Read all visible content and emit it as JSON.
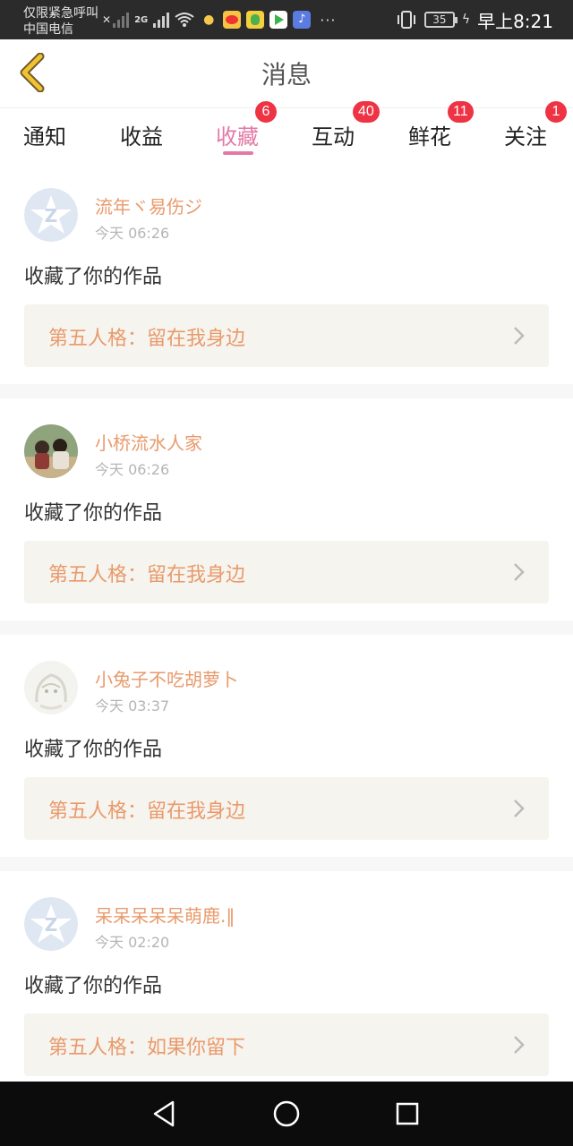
{
  "status_bar": {
    "carrier_line1": "仅限紧急呼叫",
    "carrier_line2": "中国电信",
    "network_label": "2G",
    "battery_level": "35",
    "time": "早上8:21"
  },
  "header": {
    "title": "消息"
  },
  "tabs": [
    {
      "label": "通知",
      "badge": ""
    },
    {
      "label": "收益",
      "badge": ""
    },
    {
      "label": "收藏",
      "badge": "6",
      "active": true
    },
    {
      "label": "互动",
      "badge": "40"
    },
    {
      "label": "鲜花",
      "badge": "11"
    },
    {
      "label": "关注",
      "badge": "1"
    }
  ],
  "items": [
    {
      "username": "流年ヾ易伤ジ",
      "time": "今天 06:26",
      "action": "收藏了你的作品",
      "work": "第五人格：留在我身边",
      "avatar": "default-avatar-icon"
    },
    {
      "username": "小桥流水人家",
      "time": "今天 06:26",
      "action": "收藏了你的作品",
      "work": "第五人格：留在我身边",
      "avatar": "photo-avatar"
    },
    {
      "username": "小兔子不吃胡萝卜",
      "time": "今天 03:37",
      "action": "收藏了你的作品",
      "work": "第五人格：留在我身边",
      "avatar": "sketch-avatar"
    },
    {
      "username": "呆呆呆呆呆萌鹿.‖",
      "time": "今天 02:20",
      "action": "收藏了你的作品",
      "work": "第五人格：如果你留下",
      "avatar": "default-avatar-icon"
    }
  ],
  "colors": {
    "accent_pink": "#e37aa6",
    "accent_orange": "#e99a6c",
    "badge_red": "#ee3344"
  }
}
